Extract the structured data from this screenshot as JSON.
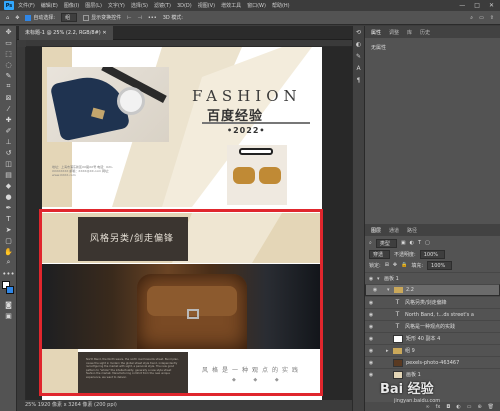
{
  "app": {
    "logo": "Ps",
    "menu": [
      "文件(F)",
      "编辑(E)",
      "图像(I)",
      "图层(L)",
      "文字(Y)",
      "选择(S)",
      "滤镜(T)",
      "3D(D)",
      "视图(V)",
      "增效工具",
      "窗口(W)",
      "帮助(H)"
    ],
    "window_controls": [
      "—",
      "□",
      "✕"
    ]
  },
  "options_bar": {
    "auto_select_label": "自动选择:",
    "auto_select_value": "组",
    "show_transform_label": "显示变换控件",
    "mode_3d_label": "3D 模式:"
  },
  "document_tab": {
    "label": "未标题-1 @ 25% (2.2, RGB/8#) ✕"
  },
  "status_bar": {
    "text": "25%      1920 像素 x 3264 像素 (200 ppi)"
  },
  "canvas": {
    "design1": {
      "headline": "FASHION",
      "subheadline": "百度经验",
      "year": "•2022•",
      "caption": "地址：上海市浦东新区XX路XX号 电话：021-XXXXXXXX 邮箱：XXXX@XX.com 网址：www.XXXX.com"
    },
    "design2": {
      "title": "风格另类/剑走偏锋",
      "body_text": "North Band, the North wears, the north road towards street. Bund plan, cause the sight in modern the global street style trend, independently reconfiguring the market with sight, a personal style. The new good pattern to \"whole\" the intellectuality, generally a new style street fashion the market. Manufacturing comfort from the new unique experience, we want to deliver.",
      "slogan": "风格是一种观点的实践",
      "bullets": "◆ ◆ ◆"
    }
  },
  "properties_panel": {
    "tabs": [
      "属性",
      "调整",
      "库",
      "历史"
    ],
    "content": "无属性"
  },
  "layers_panel": {
    "tabs": [
      "图层",
      "通道",
      "路径"
    ],
    "filter_label": "类型",
    "blend_mode": "穿透",
    "opacity_label": "不透明度:",
    "opacity_value": "100%",
    "lock_label": "锁定:",
    "fill_label": "填充:",
    "fill_value": "100%",
    "layers": [
      {
        "name": "画板 1",
        "kind": "artboard",
        "selected": false
      },
      {
        "name": "2.2",
        "kind": "group",
        "selected": true
      },
      {
        "name": "风格另类/剑走偏锋",
        "kind": "text",
        "selected": false
      },
      {
        "name": "North Band, t...ds street's a",
        "kind": "text",
        "selected": false
      },
      {
        "name": "风格是一种观点的实践",
        "kind": "text",
        "selected": false
      },
      {
        "name": "矩形 40 副本 4",
        "kind": "shape",
        "selected": false
      },
      {
        "name": "组 9",
        "kind": "group",
        "selected": false
      },
      {
        "name": "pexels-photo-463467",
        "kind": "image",
        "selected": false
      },
      {
        "name": "画板 1",
        "kind": "shape",
        "selected": false
      }
    ]
  },
  "watermark": {
    "brand": "Bai 经验",
    "url": "jingyan.baidu.com"
  }
}
